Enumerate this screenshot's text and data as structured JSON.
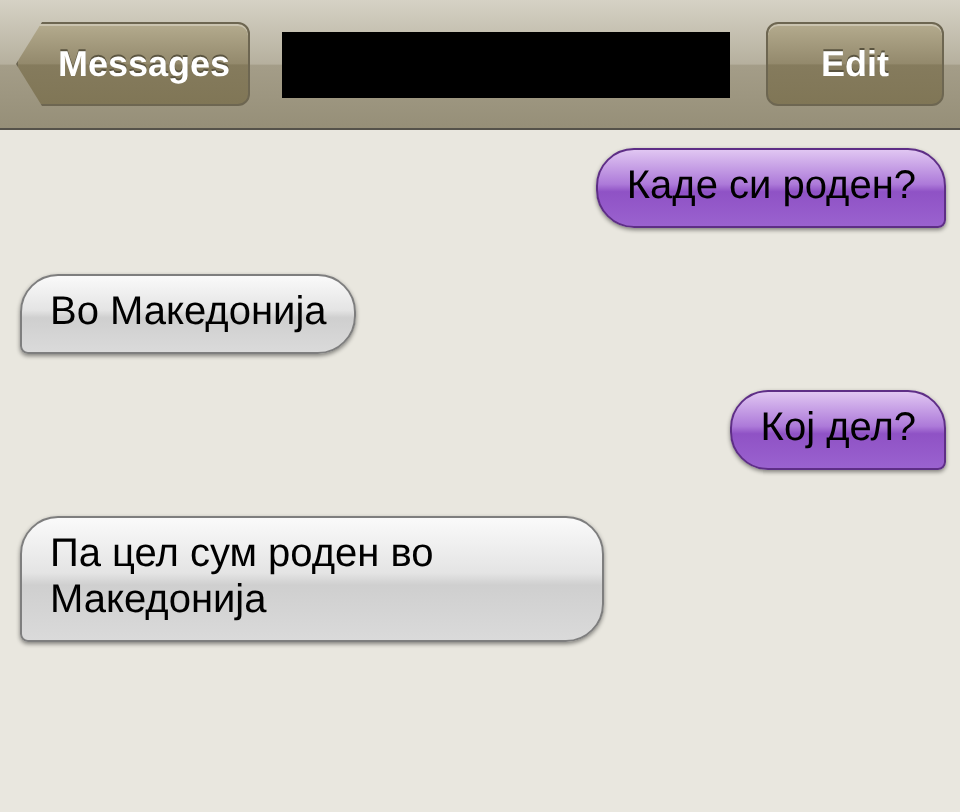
{
  "nav_bar": {
    "back_button": "Messages",
    "edit_button": "Edit"
  },
  "messages": [
    {
      "kind": "sent",
      "text": "Каде си роден?"
    },
    {
      "kind": "received",
      "text": "Во Македонија"
    },
    {
      "kind": "sent",
      "text": "Кој дел?"
    },
    {
      "kind": "received",
      "text": "Па цел сум роден во Македонија"
    }
  ]
}
